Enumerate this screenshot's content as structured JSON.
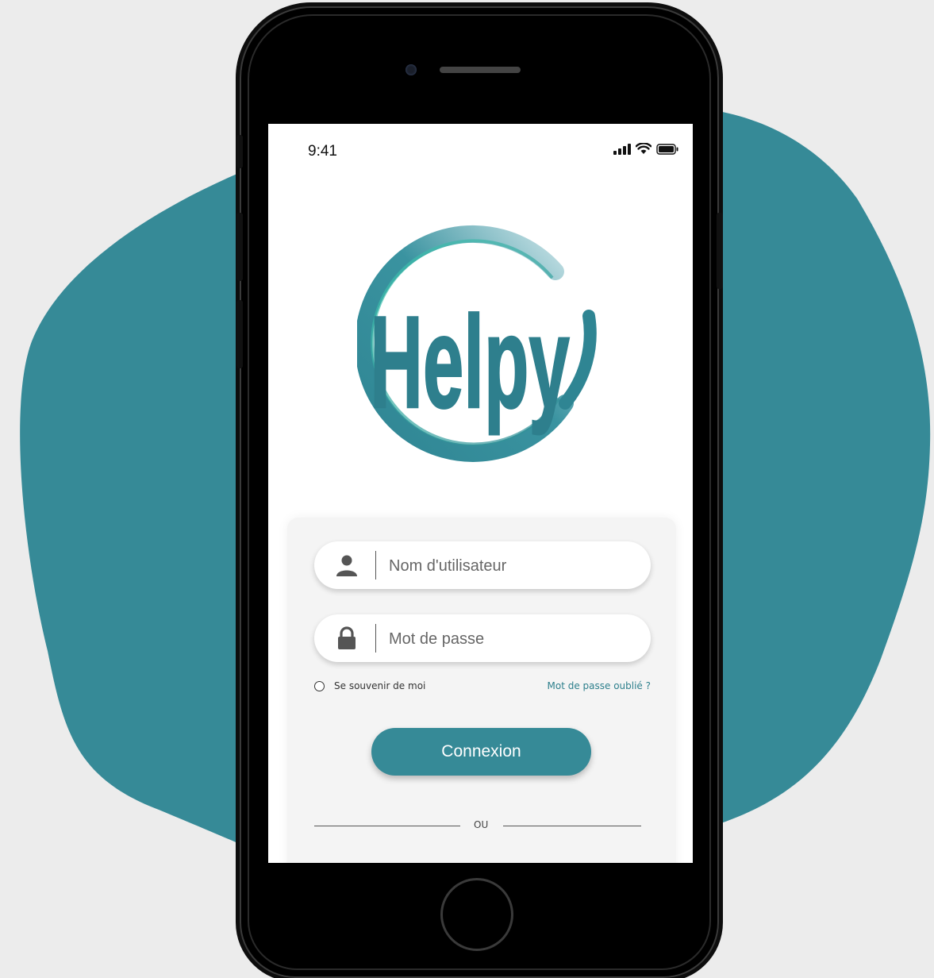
{
  "colors": {
    "accent": "#368a97",
    "accent_dark": "#2c7f8c",
    "background": "#ececec",
    "blob": "#368a97",
    "link": "#2d7f8c"
  },
  "status_bar": {
    "time": "9:41",
    "icons": [
      "signal-icon",
      "wifi-icon",
      "battery-icon"
    ]
  },
  "logo": {
    "text": "Helpy"
  },
  "login": {
    "username_placeholder": "Nom d'utilisateur",
    "password_placeholder": "Mot de passe",
    "remember_label": "Se souvenir de moi",
    "forgot_label": "Mot de passe oublié ?",
    "submit_label": "Connexion",
    "divider_label": "OU"
  }
}
